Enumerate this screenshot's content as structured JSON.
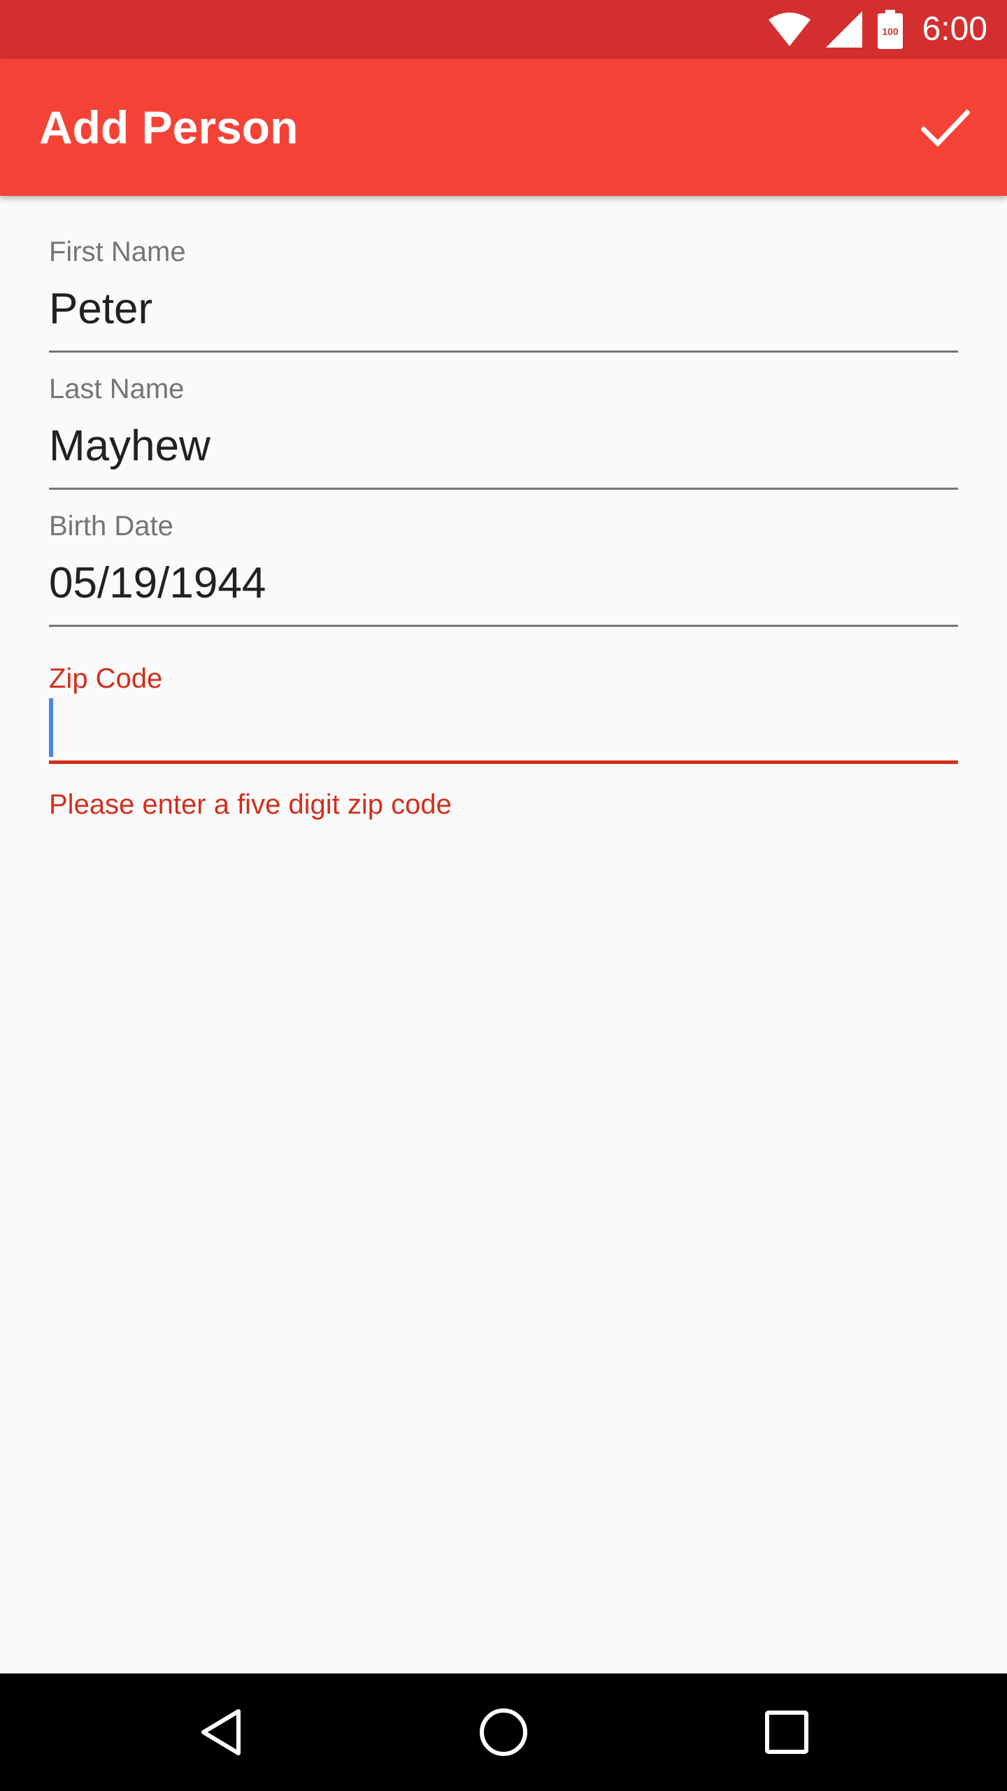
{
  "status_bar": {
    "time": "6:00",
    "battery_level": "100",
    "icons": [
      "wifi-icon",
      "cell-signal-icon",
      "battery-icon"
    ]
  },
  "app_bar": {
    "title": "Add Person",
    "action_icon": "check-icon"
  },
  "form": {
    "fields": [
      {
        "label": "First Name",
        "value": "Peter"
      },
      {
        "label": "Last Name",
        "value": "Mayhew"
      },
      {
        "label": "Birth Date",
        "value": "05/19/1944"
      }
    ],
    "zip": {
      "label": "Zip Code",
      "value": "",
      "error": "Please enter a five digit zip code"
    }
  },
  "nav_bar": {
    "buttons": [
      "back-icon",
      "home-icon",
      "recents-icon"
    ]
  },
  "colors": {
    "status_bar": "#d32f2f",
    "app_bar": "#f44336",
    "error": "#d32f1c",
    "cursor": "#4a86e8",
    "background": "#fafafa"
  }
}
